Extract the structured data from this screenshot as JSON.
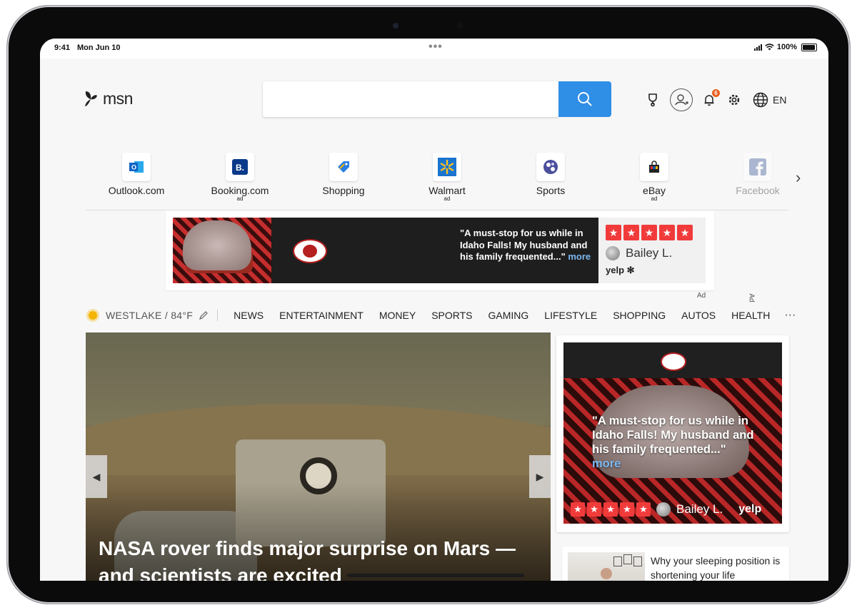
{
  "status": {
    "time": "9:41",
    "date": "Mon Jun 10",
    "battery": "100%"
  },
  "header": {
    "logo_text": "msn",
    "search": {
      "value": "",
      "placeholder": ""
    },
    "notification_count": "6",
    "language": "EN"
  },
  "quick_links": [
    {
      "label": "Outlook.com",
      "ad": "",
      "icon": "outlook-icon"
    },
    {
      "label": "Booking.com",
      "ad": "ad",
      "icon": "booking-icon"
    },
    {
      "label": "Shopping",
      "ad": "",
      "icon": "shopping-tag-icon"
    },
    {
      "label": "Walmart",
      "ad": "ad",
      "icon": "walmart-icon"
    },
    {
      "label": "Sports",
      "ad": "",
      "icon": "sports-icon"
    },
    {
      "label": "eBay",
      "ad": "ad",
      "icon": "ebay-icon"
    },
    {
      "label": "Facebook",
      "ad": "",
      "icon": "facebook-icon"
    }
  ],
  "top_ad": {
    "quote": "\"A must-stop for us while in Idaho Falls! My husband and his family frequented...\"",
    "more": "more",
    "reviewer": "Bailey L.",
    "source": "yelp",
    "label": "Ad"
  },
  "nav": {
    "weather": "WESTLAKE / 84°F",
    "items": [
      "NEWS",
      "ENTERTAINMENT",
      "MONEY",
      "SPORTS",
      "GAMING",
      "LIFESTYLE",
      "SHOPPING",
      "AUTOS",
      "HEALTH"
    ],
    "more": "···"
  },
  "hero": {
    "title": "NASA rover finds major surprise on Mars — and scientists are excited"
  },
  "side_ad": {
    "label": "Ad",
    "quote": "\"A must-stop for us while in Idaho Falls! My husband and his family frequented...\"",
    "more": "more",
    "reviewer": "Bailey L.",
    "source": "yelp"
  },
  "article_card": {
    "title": "Why your sleeping position is shortening your life"
  },
  "colors": {
    "search_button": "#2f8ee6",
    "star_red": "#f13b3b",
    "link_blue": "#7cb8f2",
    "badge_orange": "#e85d1c"
  }
}
